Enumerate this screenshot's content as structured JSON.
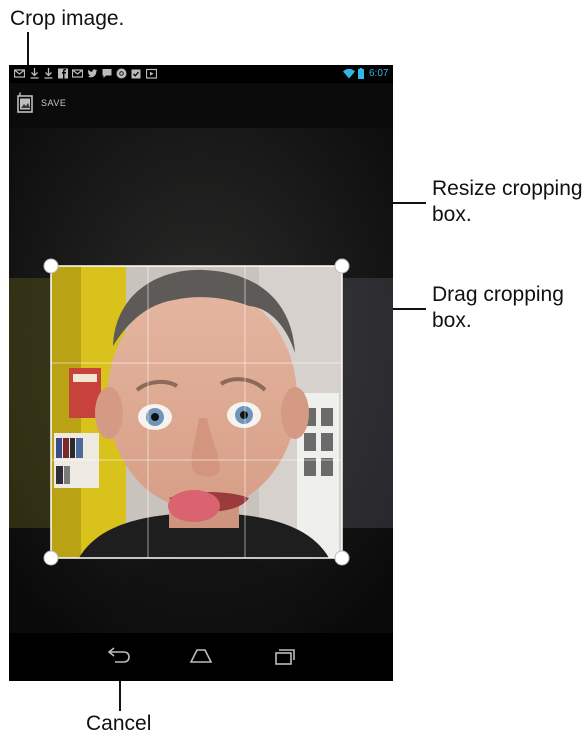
{
  "callouts": {
    "crop_image": "Crop image.",
    "resize_line1": "Resize cropping",
    "resize_line2": "box.",
    "drag_line1": "Drag cropping",
    "drag_line2": "box.",
    "cancel": "Cancel"
  },
  "status_bar": {
    "time": "6:07",
    "notification_icons": [
      "gmail-icon",
      "download-icon",
      "download-icon",
      "facebook-icon",
      "email-icon",
      "twitter-icon",
      "talk-icon",
      "chrome-icon",
      "calendar-icon",
      "youtube-icon"
    ],
    "accent_color": "#33b5e5"
  },
  "action_bar": {
    "save_label": "SAVE",
    "icon": "crop-done-icon"
  },
  "crop": {
    "handles": [
      "top-left",
      "top-right",
      "bottom-left",
      "bottom-right"
    ],
    "grid": "3x3"
  },
  "nav_bar": {
    "buttons": [
      "back-icon",
      "home-icon",
      "recent-apps-icon"
    ]
  }
}
